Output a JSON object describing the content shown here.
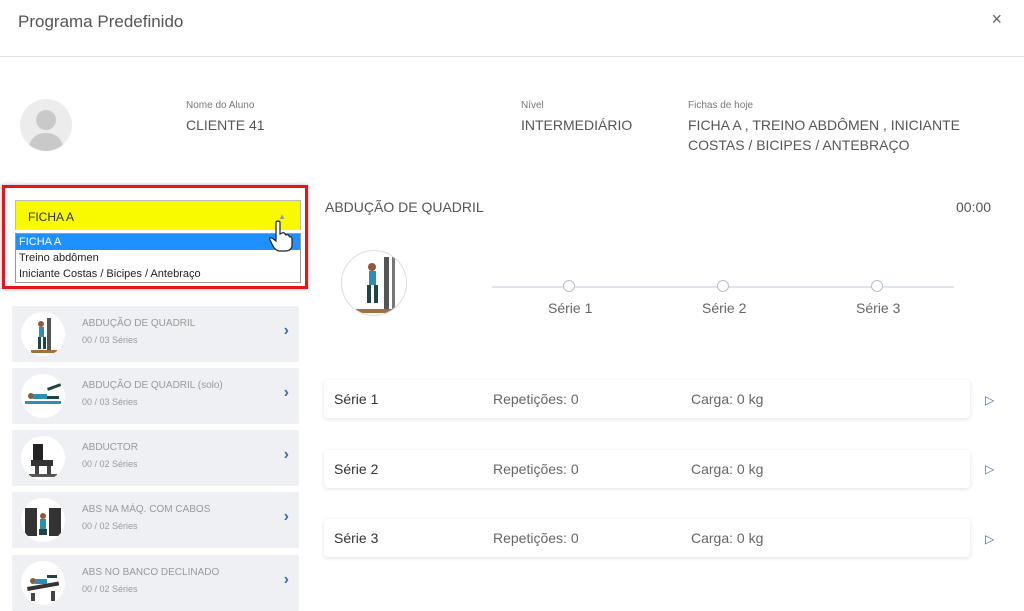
{
  "modal": {
    "title": "Programa Predefinido",
    "close_glyph": "×"
  },
  "student": {
    "name_label": "Nome do Aluno",
    "name": "CLIENTE 41",
    "level_label": "Nível",
    "level": "INTERMEDIÁRIO",
    "sheets_label": "Fichas de hoje",
    "sheets_line1": "FICHA A , TREINO ABDÔMEN , INICIANTE",
    "sheets_line2": "COSTAS / BICIPES / ANTEBRAÇO"
  },
  "select": {
    "value": "FICHA A",
    "options": [
      "FICHA A",
      "Treino abdômen",
      "Iniciante Costas / Bicipes / Antebraço"
    ]
  },
  "exercises": [
    {
      "name": "ABDUÇÃO DE QUADRIL",
      "series": "00 / 03 Séries"
    },
    {
      "name": "ABDUÇÃO DE QUADRIL (solo)",
      "series": "00 / 03 Séries"
    },
    {
      "name": "ABDUCTOR",
      "series": "00 / 02 Séries"
    },
    {
      "name": "ABS NA MÁQ. COM CABOS",
      "series": "00 / 02 Séries"
    },
    {
      "name": "ABS NO BANCO DECLINADO",
      "series": "00 / 02 Séries"
    }
  ],
  "current": {
    "title": "ABDUÇÃO DE QUADRIL",
    "timer": "00:00",
    "steps": [
      "Série 1",
      "Série 2",
      "Série 3"
    ]
  },
  "series": [
    {
      "name": "Série 1",
      "reps": "Repetições: 0",
      "load": "Carga: 0 kg"
    },
    {
      "name": "Série 2",
      "reps": "Repetições: 0",
      "load": "Carga: 0 kg"
    },
    {
      "name": "Série 3",
      "reps": "Repetições: 0",
      "load": "Carga: 0 kg"
    }
  ],
  "colors": {
    "highlight": "#e8141b",
    "select_bg": "#f9f900",
    "option_selected": "#1e90ff",
    "accent": "#3a6fb0"
  }
}
